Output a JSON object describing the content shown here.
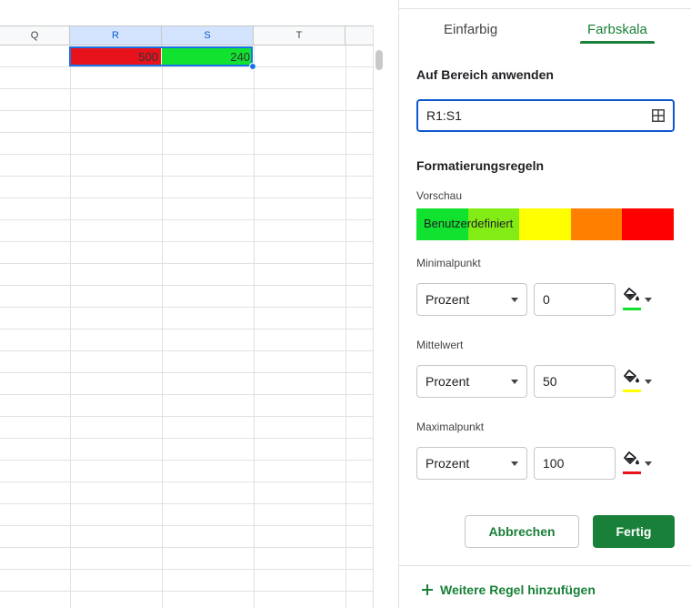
{
  "sheet": {
    "columns": [
      {
        "label": "Q",
        "selected": false
      },
      {
        "label": "R",
        "selected": true
      },
      {
        "label": "S",
        "selected": true
      },
      {
        "label": "T",
        "selected": false
      }
    ],
    "cells": [
      {
        "col": "R",
        "row": 1,
        "value": "500",
        "fill": "#e8121d"
      },
      {
        "col": "S",
        "row": 1,
        "value": "240",
        "fill": "#11e12f"
      }
    ]
  },
  "panel": {
    "tabs": [
      {
        "label": "Einfarbig",
        "active": false
      },
      {
        "label": "Farbskala",
        "active": true
      }
    ],
    "apply_range_label": "Auf Bereich anwenden",
    "range_value": "R1:S1",
    "rules_heading": "Formatierungsregeln",
    "preview_label": "Vorschau",
    "preview_text": "Benutzerdefiniert",
    "preview_colors": [
      "#11e12f",
      "#83ec15",
      "#ffff00",
      "#ff8000",
      "#ff0000"
    ],
    "min": {
      "label": "Minimalpunkt",
      "type": "Prozent",
      "value": "0",
      "color": "#11e12f"
    },
    "mid": {
      "label": "Mittelwert",
      "type": "Prozent",
      "value": "50",
      "color": "#ffff00"
    },
    "max": {
      "label": "Maximalpunkt",
      "type": "Prozent",
      "value": "100",
      "color": "#e8121d"
    },
    "cancel_label": "Abbrechen",
    "done_label": "Fertig",
    "add_rule_label": "Weitere Regel hinzufügen"
  },
  "colors": {
    "accent_green": "#188038",
    "selection_blue": "#1a73e8"
  }
}
